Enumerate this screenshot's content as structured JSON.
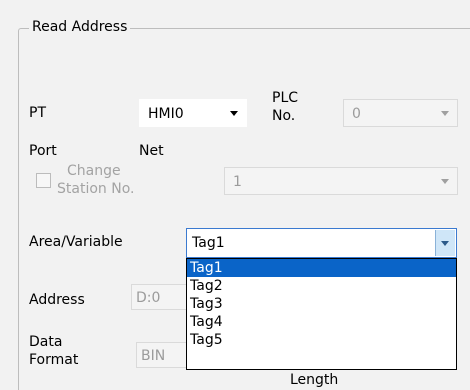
{
  "group": {
    "title": "Read Address"
  },
  "pt": {
    "label": "PT",
    "value": "HMI0"
  },
  "plc": {
    "label_line1": "PLC",
    "label_line2": "No.",
    "value": "0"
  },
  "port": {
    "label": "Port",
    "value": "Net"
  },
  "change_station": {
    "label_line1": "Change",
    "label_line2": "Station No.",
    "value": "1",
    "checked": false
  },
  "area": {
    "label": "Area/Variable",
    "value": "Tag1"
  },
  "address": {
    "label": "Address",
    "value": "D:0"
  },
  "data_format": {
    "label_line1": "Data",
    "label_line2": "Format",
    "value": "BIN",
    "behind_text": "Length"
  },
  "dropdown": {
    "options": [
      "Tag1",
      "Tag2",
      "Tag3",
      "Tag4",
      "Tag5"
    ],
    "selected": "Tag1"
  },
  "colors": {
    "selection": "#0a64c8",
    "focus_border": "#3b7ad0"
  }
}
